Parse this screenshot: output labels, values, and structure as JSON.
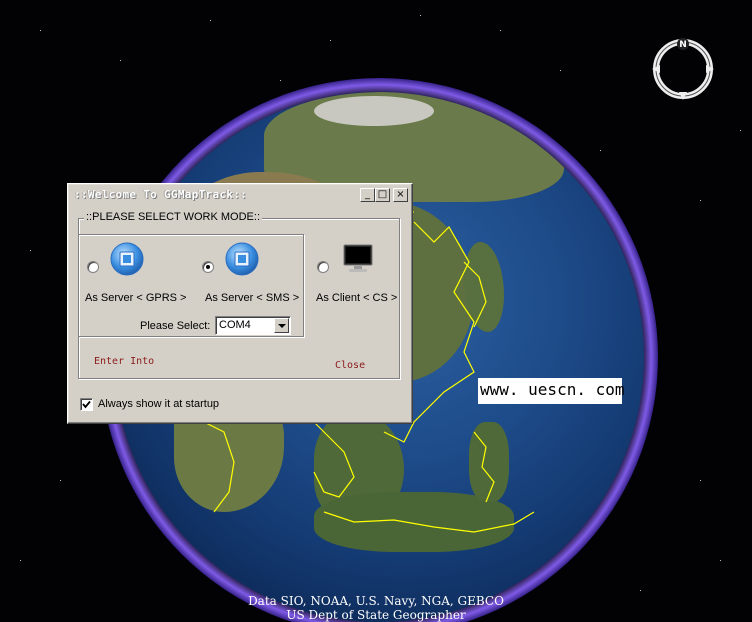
{
  "map": {
    "attribution_line1": "Data SIO, NOAA, U.S. Navy, NGA, GEBCO",
    "attribution_line2": "US Dept of State Geographer",
    "watermark": "www. uescn. com",
    "compass_icon": "compass-north-icon",
    "compass_letter": "N"
  },
  "dialog": {
    "title": "::Welcome To GGMapTrack::",
    "minimize_label": "_",
    "maximize_label": "□",
    "close_label": "×",
    "group_label": "::PLEASE SELECT WORK MODE::",
    "modes": [
      {
        "label": "As Server < GPRS >",
        "icon": "server-gprs-icon",
        "selected": false
      },
      {
        "label": "As Server < SMS >",
        "icon": "server-sms-icon",
        "selected": true
      },
      {
        "label": "As Client < CS >",
        "icon": "monitor-icon",
        "selected": false
      }
    ],
    "select_label": "Please Select:",
    "port_value": "COM4",
    "enter_label": "Enter Into",
    "close_button_label": "Close",
    "startup_label": "Always show it at startup",
    "startup_checked": true
  },
  "colors": {
    "dialog_bg": "#d4d0c8",
    "link_text": "#8b1a1a",
    "atmosphere": "#8c64ff",
    "border_line": "#ffff00"
  }
}
